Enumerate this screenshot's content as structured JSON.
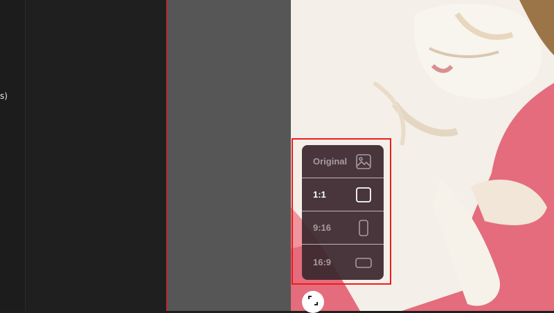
{
  "left_panel": {
    "snippet": "s)"
  },
  "aspect_menu": {
    "items": [
      {
        "label": "Original",
        "icon": "image-icon",
        "selected": false
      },
      {
        "label": "1:1",
        "icon": "square-icon",
        "selected": true
      },
      {
        "label": "9:16",
        "icon": "portrait-icon",
        "selected": false
      },
      {
        "label": "16:9",
        "icon": "landscape-icon",
        "selected": false
      }
    ]
  },
  "expand_button": {
    "icon": "expand-icon"
  },
  "colors": {
    "highlight": "#ee1c1c",
    "divider": "#c0282c",
    "menu_bg": "#3a282e"
  }
}
